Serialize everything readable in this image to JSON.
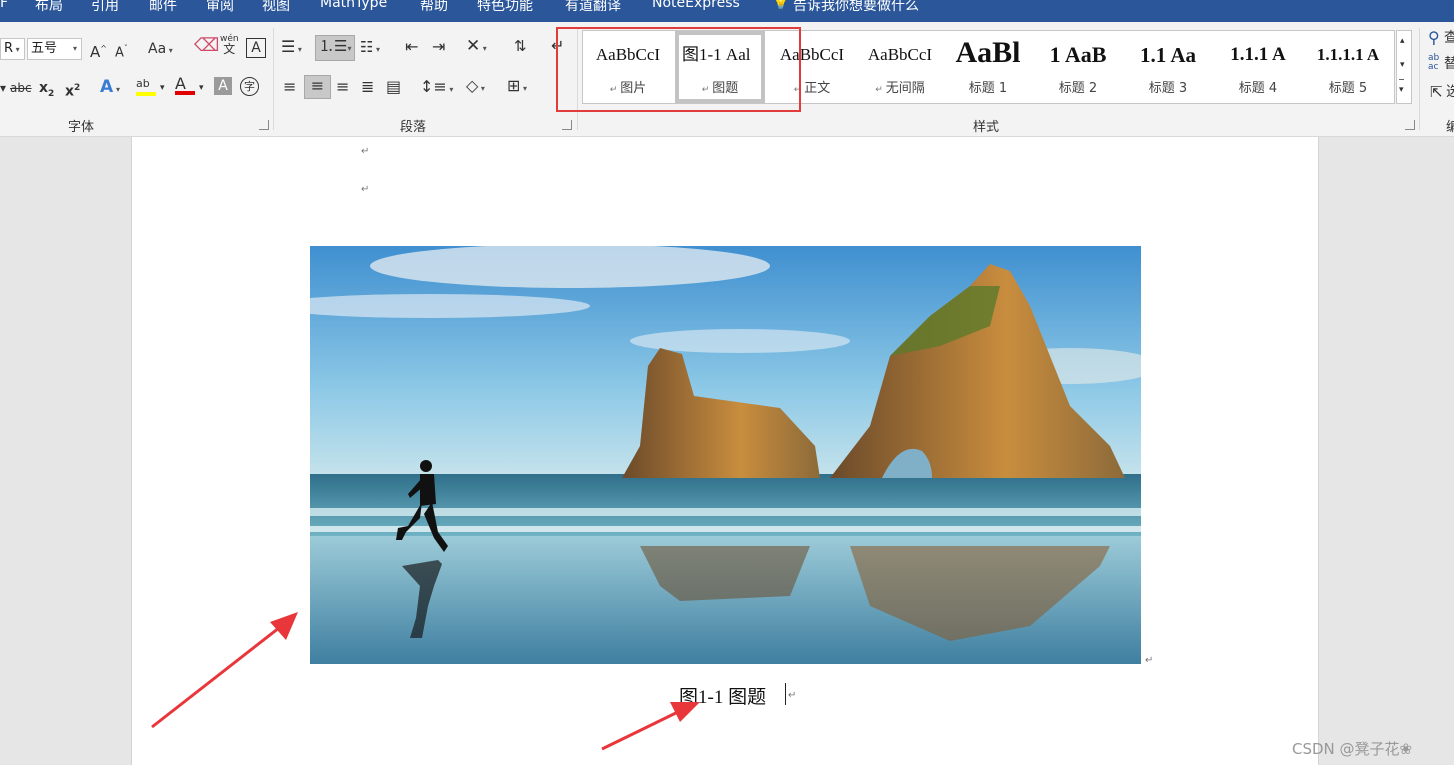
{
  "menu": {
    "items": [
      "F",
      "布局",
      "引用",
      "邮件",
      "审阅",
      "视图",
      "MathType",
      "帮助",
      "特色功能",
      "有道翻译",
      "NoteExpress"
    ],
    "tell_me": "告诉我你想要做什么"
  },
  "font_group": {
    "font_name": "R",
    "font_size": "五号",
    "grow_label": "A",
    "shrink_label": "A",
    "case_label": "Aa",
    "phonetic_top": "wén",
    "phonetic_bottom": "文",
    "strike_label": "abc",
    "sub_label": "x",
    "sub_small": "2",
    "sup_label": "x",
    "sup_small": "2",
    "effects_label": "A",
    "highlight_label": "ab",
    "fontcolor_label": "A",
    "shade_label": "A",
    "enclose_label": "字",
    "label": "字体"
  },
  "para_group": {
    "label": "段落"
  },
  "styles_group": {
    "label": "样式",
    "items": [
      {
        "preview": "AaBbCcI",
        "name": "图片"
      },
      {
        "preview": "图1-1 Aal",
        "name": "图题"
      },
      {
        "preview": "AaBbCcI",
        "name": "正文"
      },
      {
        "preview": "AaBbCcI",
        "name": "无间隔"
      },
      {
        "preview": "AaBl",
        "name": "标题 1"
      },
      {
        "preview": "1 AaB",
        "name": "标题 2"
      },
      {
        "preview": "1.1 Aa",
        "name": "标题 3"
      },
      {
        "preview": "1.1.1 A",
        "name": "标题 4"
      },
      {
        "preview": "1.1.1.1 A",
        "name": "标题 5"
      }
    ],
    "selected_index": 1
  },
  "editing_group": {
    "replace_small": "ab",
    "replace_sub": "ac",
    "find_char": "查",
    "replace_char": "替",
    "select_char": "选",
    "label": "编"
  },
  "document": {
    "paragraph_mark": "↵",
    "caption": "图1-1 图题"
  },
  "watermark": "CSDN @凳子花❀",
  "colors": {
    "menubar": "#2b579a",
    "highlight_box": "#e23b3b",
    "arrow": "#e8363a",
    "font_color_bar": "#e00000",
    "highlight_bar": "#ffff00"
  }
}
